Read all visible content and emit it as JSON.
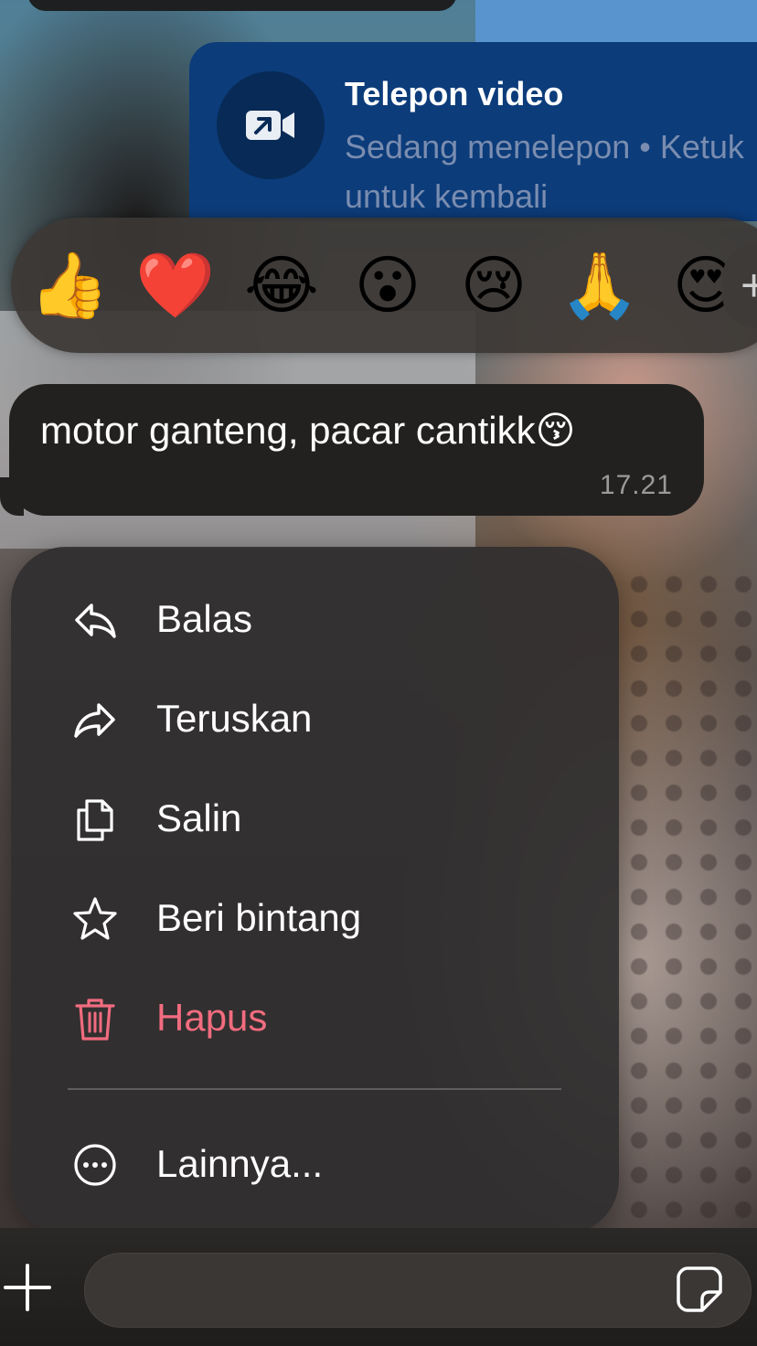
{
  "call_banner": {
    "title": "Telepon video",
    "subtitle": "Sedang menelepon • Ketuk untuk kembali",
    "icon": "video-call-icon"
  },
  "reactions": {
    "emojis": [
      "👍",
      "❤️",
      "😂",
      "😮",
      "😢",
      "🙏",
      "😍"
    ],
    "more_icon": "plus-icon",
    "more_label": "+"
  },
  "message": {
    "text": "motor ganteng, pacar cantikk😚",
    "time": "17.21"
  },
  "menu": {
    "items": [
      {
        "label": "Balas",
        "icon": "reply-icon"
      },
      {
        "label": "Teruskan",
        "icon": "forward-icon"
      },
      {
        "label": "Salin",
        "icon": "copy-icon"
      },
      {
        "label": "Beri bintang",
        "icon": "star-icon"
      },
      {
        "label": "Hapus",
        "icon": "trash-icon",
        "color": "#f26c7f"
      },
      {
        "label": "Lainnya...",
        "icon": "more-icon"
      }
    ]
  },
  "input_bar": {
    "plus_icon": "plus-icon",
    "sticker_icon": "sticker-icon",
    "placeholder": ""
  },
  "colors": {
    "call_banner_bg": "#0c3c7a",
    "bubble_bg": "#22211f",
    "menu_bg": "#302e2f",
    "danger": "#f26c7f"
  }
}
